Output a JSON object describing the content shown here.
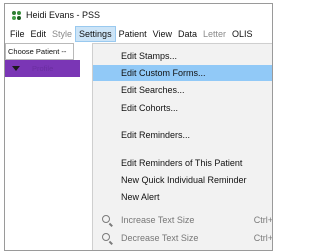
{
  "window": {
    "title": "Heidi Evans - PSS"
  },
  "menubar": {
    "items": [
      {
        "label": "File",
        "state": "normal"
      },
      {
        "label": "Edit",
        "state": "normal"
      },
      {
        "label": "Style",
        "state": "dim"
      },
      {
        "label": "Settings",
        "state": "active"
      },
      {
        "label": "Patient",
        "state": "normal"
      },
      {
        "label": "View",
        "state": "normal"
      },
      {
        "label": "Data",
        "state": "normal"
      },
      {
        "label": "Letter",
        "state": "dim"
      },
      {
        "label": "OLIS",
        "state": "normal"
      }
    ]
  },
  "sidebar": {
    "choose_patient": "Choose Patient --",
    "profile_label": "Profile"
  },
  "settings_menu": {
    "items": [
      {
        "label": "Edit Stamps...",
        "shortcut": "",
        "icon": ""
      },
      {
        "label": "Edit Custom Forms...",
        "shortcut": "",
        "icon": "",
        "highlight": true
      },
      {
        "label": "Edit Searches...",
        "shortcut": "",
        "icon": ""
      },
      {
        "label": "Edit Cohorts...",
        "shortcut": "",
        "icon": ""
      },
      {
        "label": "Edit Reminders...",
        "shortcut": "",
        "icon": ""
      },
      {
        "label": "Edit Reminders of This Patient",
        "shortcut": "",
        "icon": ""
      },
      {
        "label": "New Quick Individual Reminder",
        "shortcut": "",
        "icon": ""
      },
      {
        "label": "New Alert",
        "shortcut": "",
        "icon": ""
      },
      {
        "label": "Increase Text Size",
        "shortcut": "Ctrl+",
        "icon": "zoom-in-icon",
        "dim": true
      },
      {
        "label": "Decrease Text Size",
        "shortcut": "Ctrl+",
        "icon": "zoom-out-icon",
        "dim": true
      }
    ]
  },
  "colors": {
    "menu_highlight": "#91c9f7",
    "profile_bar": "#7a36b5"
  }
}
